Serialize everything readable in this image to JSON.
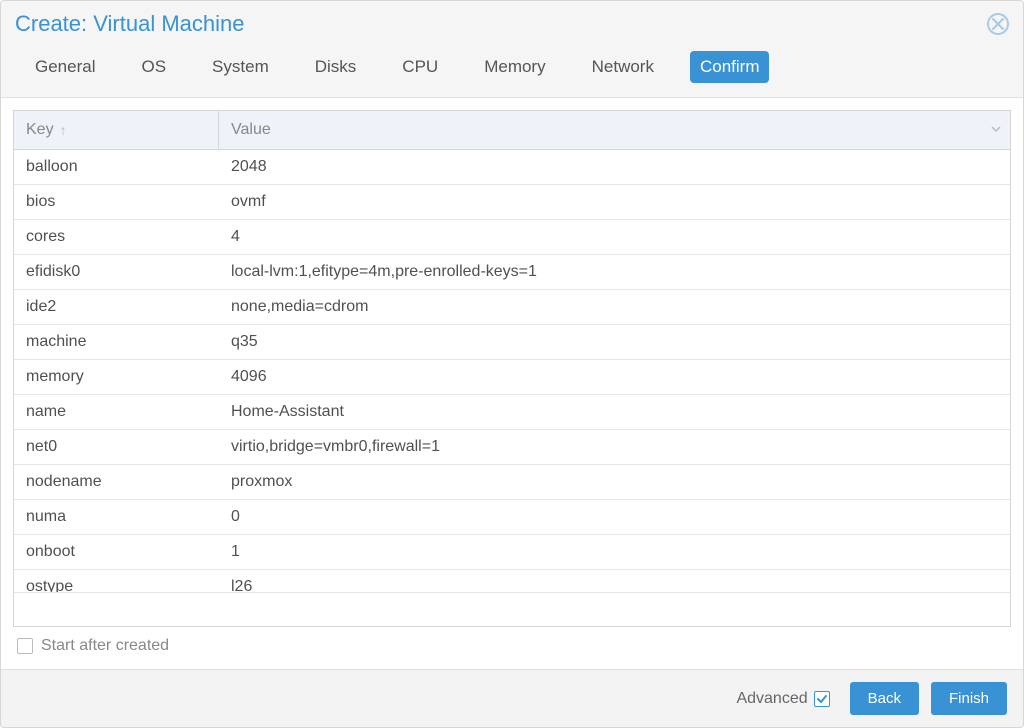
{
  "title": "Create: Virtual Machine",
  "tabs": [
    "General",
    "OS",
    "System",
    "Disks",
    "CPU",
    "Memory",
    "Network",
    "Confirm"
  ],
  "active_tab": "Confirm",
  "columns": {
    "key": "Key",
    "value": "Value"
  },
  "rows": [
    {
      "key": "balloon",
      "value": "2048"
    },
    {
      "key": "bios",
      "value": "ovmf"
    },
    {
      "key": "cores",
      "value": "4"
    },
    {
      "key": "efidisk0",
      "value": "local-lvm:1,efitype=4m,pre-enrolled-keys=1"
    },
    {
      "key": "ide2",
      "value": "none,media=cdrom"
    },
    {
      "key": "machine",
      "value": "q35"
    },
    {
      "key": "memory",
      "value": "4096"
    },
    {
      "key": "name",
      "value": "Home-Assistant"
    },
    {
      "key": "net0",
      "value": "virtio,bridge=vmbr0,firewall=1"
    },
    {
      "key": "nodename",
      "value": "proxmox"
    },
    {
      "key": "numa",
      "value": "0"
    },
    {
      "key": "onboot",
      "value": "1"
    },
    {
      "key": "ostype",
      "value": "l26"
    }
  ],
  "start_after_label": "Start after created",
  "start_after_checked": false,
  "advanced_label": "Advanced",
  "advanced_checked": true,
  "buttons": {
    "back": "Back",
    "finish": "Finish"
  }
}
